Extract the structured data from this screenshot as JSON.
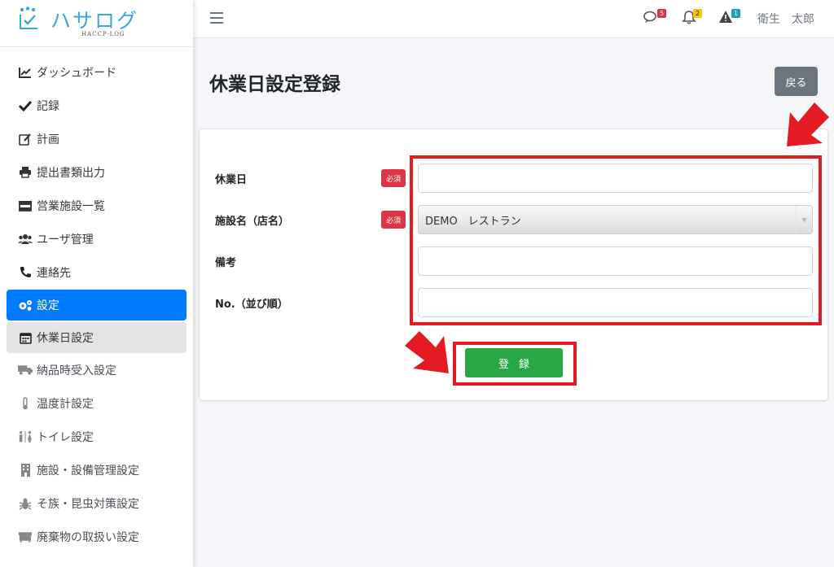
{
  "brand": {
    "name": "ハサログ",
    "sub": "HACCP-LOG"
  },
  "sidebar": {
    "items": [
      {
        "label": "ダッシュボード",
        "icon": "chart-line-icon"
      },
      {
        "label": "記録",
        "icon": "check-icon"
      },
      {
        "label": "計画",
        "icon": "edit-icon"
      },
      {
        "label": "提出書類出力",
        "icon": "printer-icon"
      },
      {
        "label": "営業施設一覧",
        "icon": "store-icon"
      },
      {
        "label": "ユーザ管理",
        "icon": "users-icon"
      },
      {
        "label": "連絡先",
        "icon": "phone-icon"
      },
      {
        "label": "設定",
        "icon": "gears-icon"
      },
      {
        "label": "休業日設定",
        "icon": "calendar-icon"
      },
      {
        "label": "納品時受入設定",
        "icon": "truck-icon"
      },
      {
        "label": "温度計設定",
        "icon": "thermometer-icon"
      },
      {
        "label": "トイレ設定",
        "icon": "restroom-icon"
      },
      {
        "label": "施設・設備管理設定",
        "icon": "building-icon"
      },
      {
        "label": "そ族・昆虫対策設定",
        "icon": "bug-icon"
      },
      {
        "label": "廃棄物の取扱い設定",
        "icon": "dumpster-icon"
      }
    ]
  },
  "topbar": {
    "messages_count": "5",
    "notifications_count": "2",
    "alerts_count": "1",
    "user_name": "衛生　太郎"
  },
  "page": {
    "title": "休業日設定登録",
    "back_label": "戻る"
  },
  "form": {
    "required_label": "必須",
    "holiday_label": "休業日",
    "holiday_value": "",
    "facility_label": "施設名（店名）",
    "facility_value": "DEMO　レストラン",
    "note_label": "備考",
    "note_value": "",
    "order_label": "No.（並び順）",
    "order_value": "",
    "submit_label": "登録"
  },
  "colors": {
    "primary": "#007bff",
    "danger": "#dc3545",
    "success": "#28a745",
    "secondary": "#6c757d",
    "highlight": "#e41b23"
  }
}
